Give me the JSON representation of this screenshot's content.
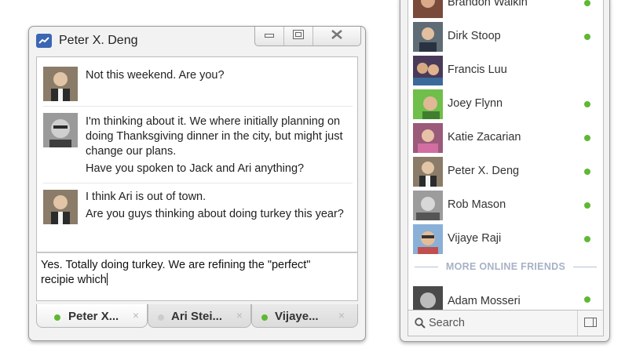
{
  "chat_window": {
    "title": "Peter X. Deng",
    "messages": [
      {
        "sender": "Peter X. Deng",
        "lines": [
          "Not this weekend. Are you?"
        ]
      },
      {
        "sender": "other",
        "lines": [
          "I'm thinking about it. We where initially planning on",
          "doing Thanksgiving dinner in the city, but might just",
          "change our plans.",
          "Have you spoken to Jack and Ari anything?"
        ]
      },
      {
        "sender": "Peter X. Deng",
        "lines": [
          "I think Ari is out of town.",
          "Are you guys thinking about doing turkey this year?"
        ]
      }
    ],
    "composer": {
      "line1": "Yes. Totally doing turkey. We are refining the \"perfect\"",
      "line2": "recipie which"
    },
    "tabs": [
      {
        "label": "Peter X...",
        "status": "online",
        "close": "×"
      },
      {
        "label": "Ari Stei...",
        "status": "offline",
        "close": "×"
      },
      {
        "label": "Vijaye...",
        "status": "online",
        "close": "×"
      }
    ]
  },
  "friends": {
    "items": [
      {
        "name": "Brandon Walkin",
        "online": true
      },
      {
        "name": "Dirk Stoop",
        "online": true
      },
      {
        "name": "Francis Luu",
        "online": false
      },
      {
        "name": "Joey Flynn",
        "online": true
      },
      {
        "name": "Katie Zacarian",
        "online": true
      },
      {
        "name": "Peter X. Deng",
        "online": true
      },
      {
        "name": "Rob Mason",
        "online": true
      },
      {
        "name": "Vijaye Raji",
        "online": true
      }
    ],
    "more_label": "MORE ONLINE FRIENDS",
    "more_items": [
      {
        "name": "Adam Mosseri",
        "online": true
      }
    ],
    "search_label": "Search"
  },
  "colors": {
    "online": "#5fb834",
    "offline": "#cccccc",
    "brand": "#3b66b3"
  }
}
